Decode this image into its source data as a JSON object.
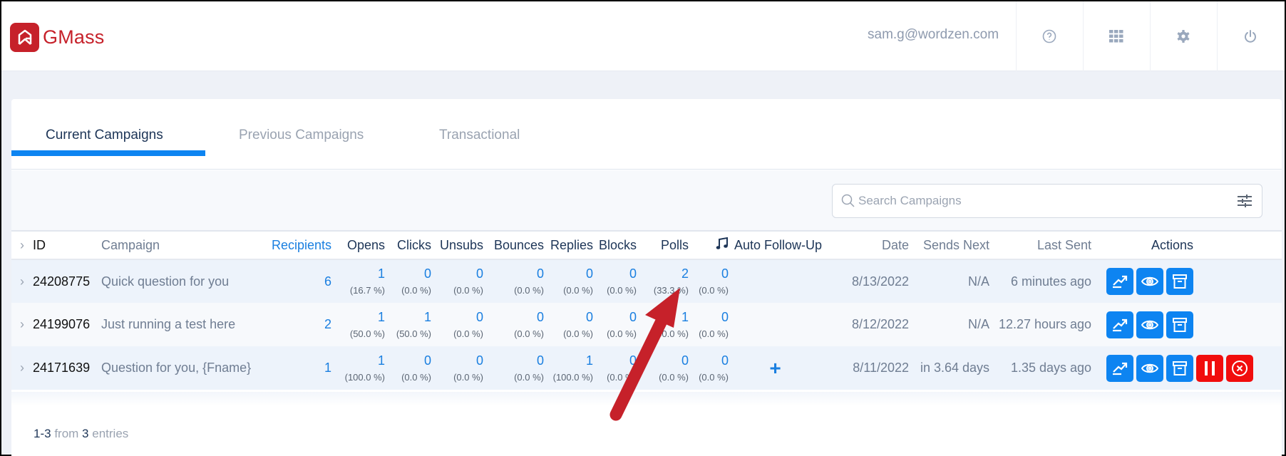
{
  "app": {
    "brand": "GMass",
    "brand_color": "#c6212a",
    "accent_color": "#0d84f1",
    "user_email": "sam.g@wordzen.com",
    "header_icons": [
      "help-icon",
      "apps-grid-icon",
      "gear-icon",
      "power-icon"
    ]
  },
  "tabs": [
    {
      "label": "Current Campaigns",
      "active": true
    },
    {
      "label": "Previous Campaigns",
      "active": false
    },
    {
      "label": "Transactional",
      "active": false
    }
  ],
  "search": {
    "placeholder": "Search Campaigns",
    "value": ""
  },
  "table": {
    "columns": {
      "id": "ID",
      "campaign": "Campaign",
      "recipients": "Recipients",
      "opens": "Opens",
      "clicks": "Clicks",
      "unsubs": "Unsubs",
      "bounces": "Bounces",
      "replies": "Replies",
      "blocks": "Blocks",
      "polls": "Polls",
      "music": "",
      "auto_follow_up": "Auto Follow-Up",
      "date": "Date",
      "sends_next": "Sends Next",
      "last_sent": "Last Sent",
      "actions": "Actions"
    },
    "rows": [
      {
        "id": "24208775",
        "campaign": "Quick question for you",
        "recipients": "6",
        "opens": {
          "n": "1",
          "p": "(16.7 %)"
        },
        "clicks": {
          "n": "0",
          "p": "(0.0 %)"
        },
        "unsubs": {
          "n": "0",
          "p": "(0.0 %)"
        },
        "bounces": {
          "n": "0",
          "p": "(0.0 %)"
        },
        "replies": {
          "n": "0",
          "p": "(0.0 %)"
        },
        "blocks": {
          "n": "0",
          "p": "(0.0 %)"
        },
        "polls": {
          "n": "2",
          "p": "(33.3 %)"
        },
        "music": {
          "n": "0",
          "p": "(0.0 %)"
        },
        "auto_follow_up": "",
        "date": "8/13/2022",
        "sends_next": "N/A",
        "last_sent": "6 minutes ago",
        "actions": [
          "reports",
          "view",
          "archive"
        ]
      },
      {
        "id": "24199076",
        "campaign": "Just running a test here",
        "recipients": "2",
        "opens": {
          "n": "1",
          "p": "(50.0 %)"
        },
        "clicks": {
          "n": "1",
          "p": "(50.0 %)"
        },
        "unsubs": {
          "n": "0",
          "p": "(0.0 %)"
        },
        "bounces": {
          "n": "0",
          "p": "(0.0 %)"
        },
        "replies": {
          "n": "0",
          "p": "(0.0 %)"
        },
        "blocks": {
          "n": "0",
          "p": "(0.0 %)"
        },
        "polls": {
          "n": "1",
          "p": "(50.0 %)"
        },
        "music": {
          "n": "0",
          "p": "(0.0 %)"
        },
        "auto_follow_up": "",
        "date": "8/12/2022",
        "sends_next": "N/A",
        "last_sent": "12.27 hours ago",
        "actions": [
          "reports",
          "view",
          "archive"
        ]
      },
      {
        "id": "24171639",
        "campaign": "Question for you, {Fname}",
        "recipients": "1",
        "opens": {
          "n": "1",
          "p": "(100.0 %)"
        },
        "clicks": {
          "n": "0",
          "p": "(0.0 %)"
        },
        "unsubs": {
          "n": "0",
          "p": "(0.0 %)"
        },
        "bounces": {
          "n": "0",
          "p": "(0.0 %)"
        },
        "replies": {
          "n": "1",
          "p": "(100.0 %)"
        },
        "blocks": {
          "n": "0",
          "p": "(0.0 %)"
        },
        "polls": {
          "n": "0",
          "p": "(0.0 %)"
        },
        "music": {
          "n": "0",
          "p": "(0.0 %)"
        },
        "auto_follow_up": "+",
        "date": "8/11/2022",
        "sends_next": "in 3.64 days",
        "last_sent": "1.35 days ago",
        "actions": [
          "reports",
          "view",
          "archive",
          "pause",
          "cancel"
        ]
      }
    ]
  },
  "footer": {
    "range": "1-3",
    "from_label": "from",
    "total": "3",
    "entries_label": "entries"
  },
  "annotation": {
    "type": "red-arrow",
    "color": "#c6212a",
    "points_to": "Polls column"
  }
}
